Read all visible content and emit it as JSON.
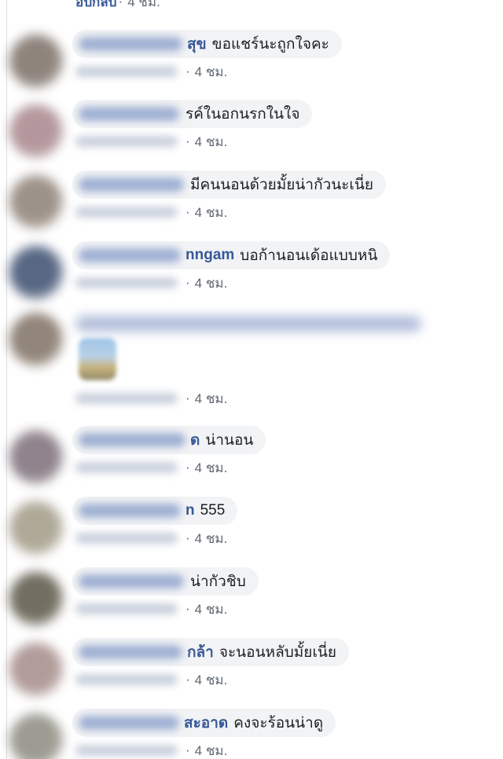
{
  "top": {
    "reply_text": "อ่ปกลับ",
    "time": "4 ชม."
  },
  "colors": {
    "link": "#385898",
    "bubble_bg": "#f2f3f5",
    "meta": "#606770"
  },
  "comments": [
    {
      "author_visible": "สุข",
      "text": "ขอแชร์นะถูกใจคะ",
      "time": "4 ชม.",
      "avatar_color": "#7b6f66"
    },
    {
      "author_visible": "",
      "text": "รค์ในอกนรกในใจ",
      "time": "4 ชม.",
      "avatar_color": "#a7868b"
    },
    {
      "author_visible": "",
      "text": "มีคนนอนด้วยมั้ยน่ากัวนะเนี่ย",
      "time": "4 ชม.",
      "avatar_color": "#8d8075"
    },
    {
      "author_visible": "nngam",
      "text": "บอก้านอนเด้อแบบหนิ",
      "time": "4 ชม.",
      "avatar_color": "#3a4d6f"
    },
    {
      "author_visible": "",
      "text": "",
      "time": "4 ชม.",
      "avatar_color": "#7f7063",
      "has_media": true
    },
    {
      "author_visible": "ด",
      "text": "น่านอน",
      "time": "4 ชม.",
      "avatar_color": "#7c6d78"
    },
    {
      "author_visible": "n",
      "text": "555",
      "time": "4 ชม.",
      "avatar_color": "#a19a86"
    },
    {
      "author_visible": "",
      "text": "น่ากัวชิบ",
      "time": "4 ชม.",
      "avatar_color": "#5a5646"
    },
    {
      "author_visible": "กล้า",
      "text": "จะนอนหลับมั้ยเนี่ย",
      "time": "4 ชม.",
      "avatar_color": "#a48b88"
    },
    {
      "author_visible": "สะอาด",
      "text": "คงจะร้อนน่าดู",
      "time": "4 ชม.",
      "avatar_color": "#8c8b80"
    }
  ]
}
